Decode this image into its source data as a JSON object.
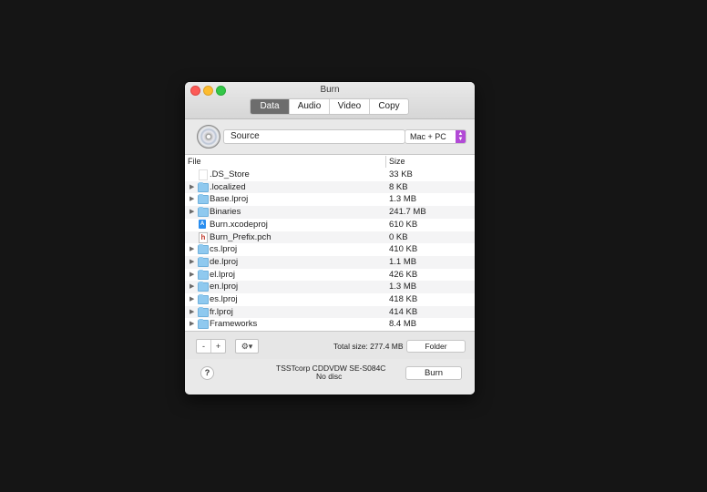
{
  "window": {
    "title": "Burn"
  },
  "tabs": [
    {
      "label": "Data",
      "active": true
    },
    {
      "label": "Audio",
      "active": false
    },
    {
      "label": "Video",
      "active": false
    },
    {
      "label": "Copy",
      "active": false
    }
  ],
  "source": {
    "value": "Source",
    "disc_format": "Mac + PC",
    "accent_color": "#b24ad6"
  },
  "table": {
    "columns": [
      "File",
      "Size"
    ],
    "rows": [
      {
        "name": ".DS_Store",
        "size": "33 KB",
        "icon": "document-icon",
        "expandable": false
      },
      {
        "name": ".localized",
        "size": "8 KB",
        "icon": "folder-icon",
        "expandable": true
      },
      {
        "name": "Base.lproj",
        "size": "1.3 MB",
        "icon": "folder-icon",
        "expandable": true
      },
      {
        "name": "Binaries",
        "size": "241.7 MB",
        "icon": "folder-icon",
        "expandable": true
      },
      {
        "name": "Burn.xcodeproj",
        "size": "610 KB",
        "icon": "xcodeproj-icon",
        "expandable": false
      },
      {
        "name": "Burn_Prefix.pch",
        "size": "0 KB",
        "icon": "header-file-icon",
        "expandable": false
      },
      {
        "name": "cs.lproj",
        "size": "410 KB",
        "icon": "folder-icon",
        "expandable": true
      },
      {
        "name": "de.lproj",
        "size": "1.1 MB",
        "icon": "folder-icon",
        "expandable": true
      },
      {
        "name": "el.lproj",
        "size": "426 KB",
        "icon": "folder-icon",
        "expandable": true
      },
      {
        "name": "en.lproj",
        "size": "1.3 MB",
        "icon": "folder-icon",
        "expandable": true
      },
      {
        "name": "es.lproj",
        "size": "418 KB",
        "icon": "folder-icon",
        "expandable": true
      },
      {
        "name": "fr.lproj",
        "size": "414 KB",
        "icon": "folder-icon",
        "expandable": true
      },
      {
        "name": "Frameworks",
        "size": "8.4 MB",
        "icon": "folder-icon",
        "expandable": true
      }
    ]
  },
  "toolbar": {
    "remove_label": "-",
    "add_label": "+",
    "gear_label": "⚙▾",
    "total_size": "Total size: 277.4 MB",
    "folder_label": "Folder"
  },
  "footer": {
    "help_label": "?",
    "device_name": "TSSTcorp CDDVDW SE-S084C",
    "device_status": "No disc",
    "burn_label": "Burn"
  }
}
